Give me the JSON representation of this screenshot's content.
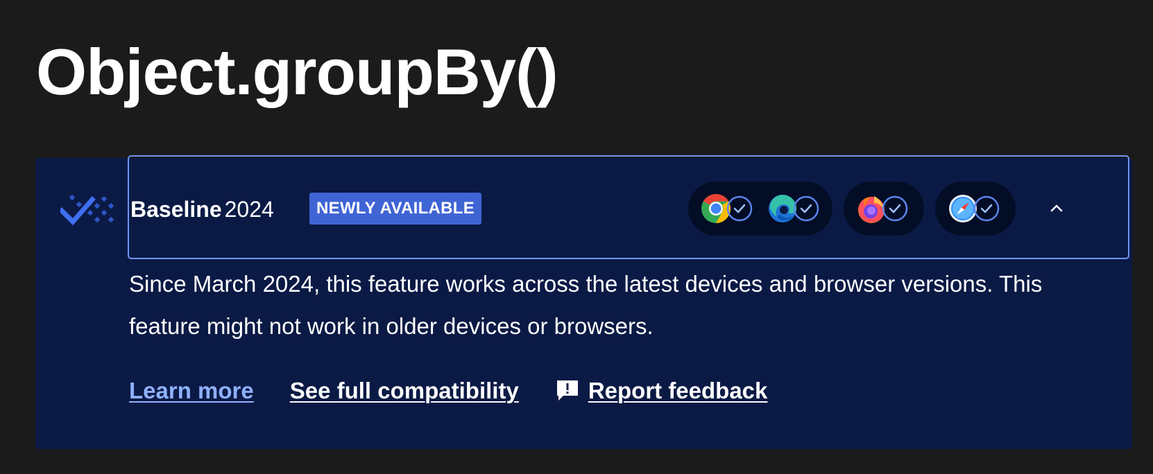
{
  "page": {
    "title": "Object.groupBy()"
  },
  "baseline": {
    "label_strong": "Baseline",
    "label_year": "2024",
    "badge": "NEWLY AVAILABLE",
    "description": "Since March 2024, this feature works across the latest devices and browser versions. This feature might not work in older devices or browsers.",
    "browser_groups": [
      {
        "browsers": [
          {
            "icon": "chrome-icon",
            "status": "supported"
          },
          {
            "icon": "edge-icon",
            "status": "supported"
          }
        ]
      },
      {
        "browsers": [
          {
            "icon": "firefox-icon",
            "status": "supported"
          }
        ]
      },
      {
        "browsers": [
          {
            "icon": "safari-icon",
            "status": "supported"
          }
        ]
      }
    ],
    "expanded_indicator": "chevron-up-icon"
  },
  "links": {
    "learn_more": "Learn more",
    "see_full_compatibility": "See full compatibility",
    "report_feedback": "Report feedback"
  },
  "colors": {
    "page_background": "#1b1b1b",
    "panel_background": "#0b1a45",
    "focus_outline": "#6d95f0",
    "badge_background": "#3f64d4",
    "link_accent": "#8fb1ff",
    "pill_background": "#030d26"
  }
}
